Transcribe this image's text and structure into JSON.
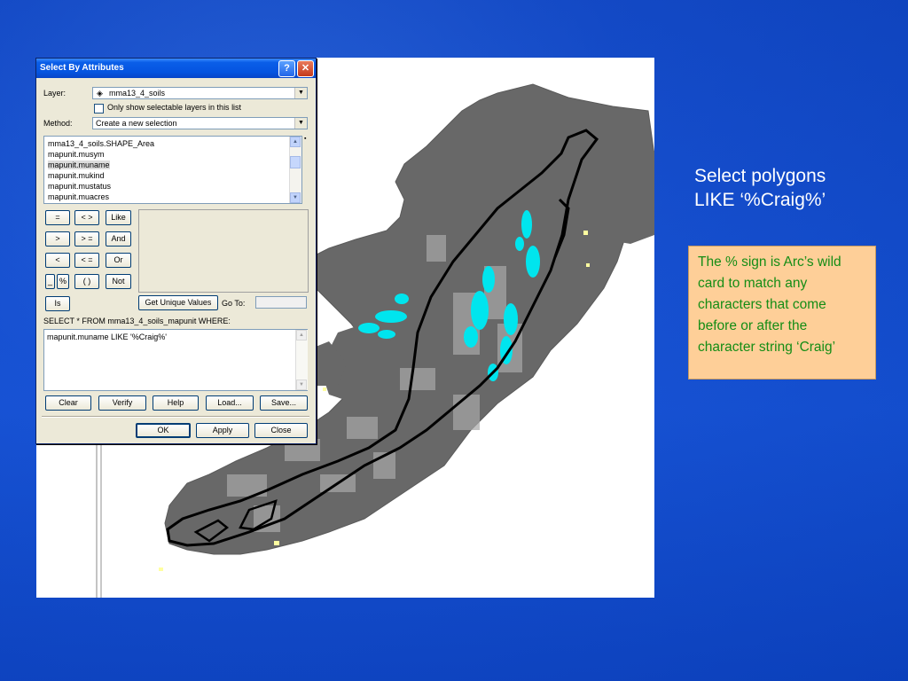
{
  "dialog": {
    "title": "Select By Attributes",
    "help_button": "?",
    "close_button": "✕",
    "layer_label": "Layer:",
    "layer_value": "mma13_4_soils",
    "only_selectable_label": "Only show selectable layers in this list",
    "method_label": "Method:",
    "method_value": "Create a new selection",
    "fields": [
      "mma13_4_soils.SHAPE_Area",
      "mapunit.musym",
      "mapunit.muname",
      "mapunit.mukind",
      "mapunit.mustatus",
      "mapunit.muacres"
    ],
    "selected_field": "mapunit.muname",
    "operators": {
      "eq": "=",
      "ne": "< >",
      "like": "Like",
      "gt": ">",
      "ge": "> =",
      "and": "And",
      "lt": "<",
      "le": "< =",
      "or": "Or",
      "underscore": "_",
      "percent": "%",
      "parens": "( )",
      "not": "Not",
      "is": "Is"
    },
    "get_unique_values": "Get Unique Values",
    "go_to_label": "Go To:",
    "query_prefix": "SELECT * FROM mma13_4_soils_mapunit WHERE:",
    "query_text": "mapunit.muname LIKE '%Craig%'",
    "buttons": {
      "clear": "Clear",
      "verify": "Verify",
      "help": "Help",
      "load": "Load...",
      "save": "Save...",
      "ok": "OK",
      "apply": "Apply",
      "close": "Close"
    }
  },
  "slide": {
    "heading_line1": "Select polygons",
    "heading_line2": "LIKE ‘%Craig%’",
    "note": "The % sign is Arc’s wild card to match any characters that come before or after the character string ‘Craig’"
  },
  "colors": {
    "background": "#1650d2",
    "note_box": "#fecf98",
    "note_text": "#158d15",
    "selection_highlight": "#00e5ee",
    "polygon_fill": "#686868"
  }
}
